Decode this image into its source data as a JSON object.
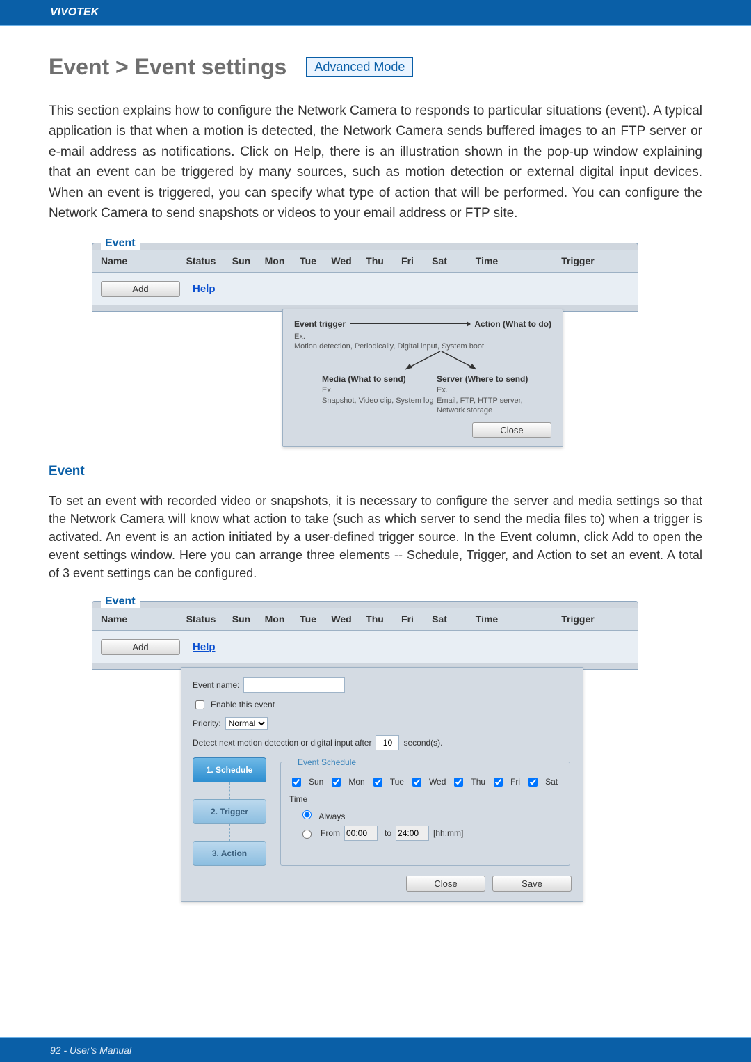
{
  "brand": "VIVOTEK",
  "page_footer": "92 - User's Manual",
  "title": "Event > Event settings",
  "mode_chip": "Advanced Mode",
  "intro": "This section explains how to configure the Network Camera to responds to particular situations (event). A typical application is that when a motion is detected, the Network Camera sends buffered images to an FTP server or e-mail address as notifications. Click on Help, there is an illustration shown in the pop-up window explaining that an event can be triggered by many sources, such as motion detection or external digital input devices. When an event is triggered, you can specify what type of action that will be performed. You can configure the Network Camera to send snapshots or videos to your email address or FTP site.",
  "intro_bold_word": "Help",
  "section_head": "Event",
  "body2": "To set an event with recorded video or snapshots, it is necessary to configure the server and media settings so that the Network Camera will know what action to take (such as which server to send the media files to) when a trigger is activated. An event is an action initiated by a user-defined trigger source. In the Event  column, click Add to open the event settings window. Here you can arrange three elements -- Schedule, Trigger, and Action to set an event. A total of 3 event settings can be configured.",
  "body2_bold_words": [
    "Event",
    "Add",
    "Schedule",
    "Trigger",
    "Action"
  ],
  "event_table": {
    "legend": "Event",
    "headers": [
      "Name",
      "Status",
      "Sun",
      "Mon",
      "Tue",
      "Wed",
      "Thu",
      "Fri",
      "Sat",
      "Time",
      "Trigger"
    ],
    "add_label": "Add",
    "help_label": "Help"
  },
  "diagram": {
    "trigger_title": "Event trigger",
    "trigger_ex": "Ex.",
    "trigger_sub": "Motion detection, Periodically, Digital input, System boot",
    "action_title": "Action (What to do)",
    "media_title": "Media (What to send)",
    "media_ex": "Ex.",
    "media_sub": "Snapshot, Video clip, System log",
    "server_title": "Server (Where to send)",
    "server_ex": "Ex.",
    "server_sub": "Email, FTP, HTTP server, Network storage",
    "close_label": "Close"
  },
  "settings": {
    "event_name_label": "Event name:",
    "event_name_value": "",
    "enable_label": "Enable this event",
    "priority_label": "Priority:",
    "priority_value": "Normal",
    "detect_label_pre": "Detect next motion detection or digital input after",
    "detect_value": "10",
    "detect_label_post": "second(s).",
    "steps": [
      "1. Schedule",
      "2. Trigger",
      "3. Action"
    ],
    "schedule_legend": "Event Schedule",
    "days": [
      "Sun",
      "Mon",
      "Tue",
      "Wed",
      "Thu",
      "Fri",
      "Sat"
    ],
    "time_label": "Time",
    "always_label": "Always",
    "from_label": "From",
    "from_value": "00:00",
    "to_label": "to",
    "to_value": "24:00",
    "hhmm": "[hh:mm]",
    "close_label": "Close",
    "save_label": "Save"
  }
}
